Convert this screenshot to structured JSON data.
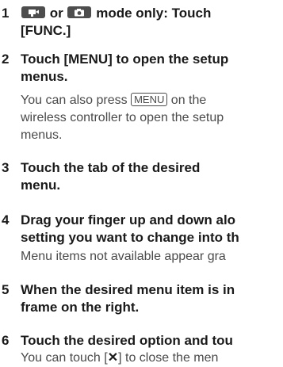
{
  "steps": [
    {
      "number": "1",
      "title_parts": [
        "or",
        "mode only: Touch"
      ],
      "title_line2": "[FUNC.]",
      "icons": [
        "movie-mode-icon",
        "photo-mode-icon"
      ]
    },
    {
      "number": "2",
      "title_line1": "Touch [MENU] to open the setup",
      "title_line2": "menus.",
      "body_prefix": "You can also press",
      "body_key": "MENU",
      "body_suffix": "on the",
      "body_line2": "wireless controller to open the setup",
      "body_line3": "menus."
    },
    {
      "number": "3",
      "title_line1": "Touch the tab of the desired",
      "title_line2": "menu."
    },
    {
      "number": "4",
      "title_line1": "Drag your finger up and down alo",
      "title_line2": "setting you want to change into th",
      "body_line1": "Menu items not available appear gra"
    },
    {
      "number": "5",
      "title_line1": "When the desired menu item is in",
      "title_line2": "frame on the right."
    },
    {
      "number": "6",
      "title_line1": "Touch the desired option and tou",
      "body_prefix": "You can touch [",
      "body_icon": "close-x-icon",
      "body_suffix": "] to close the men"
    }
  ]
}
